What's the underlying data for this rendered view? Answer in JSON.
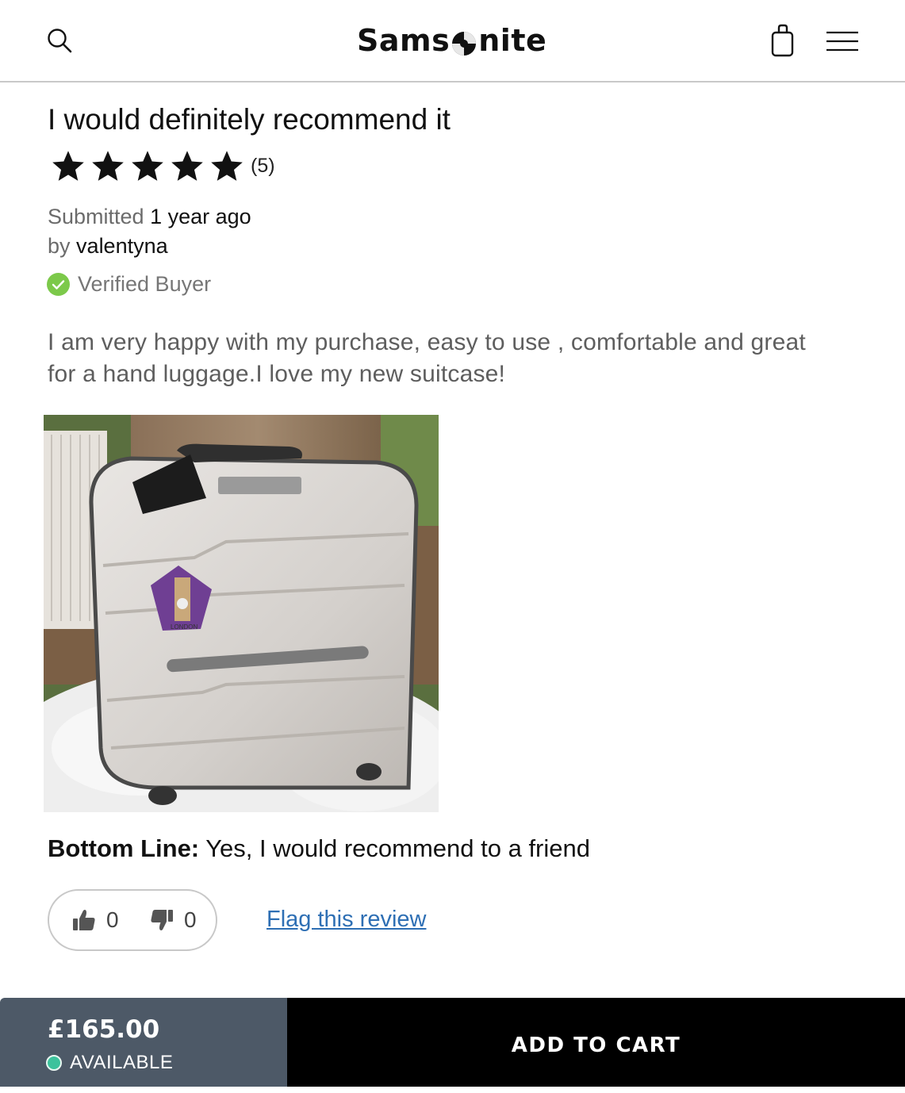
{
  "header": {
    "logo_text_left": "Sams",
    "logo_text_right": "nite",
    "icons": [
      "search-icon",
      "shopping-bag-icon",
      "hamburger-menu-icon"
    ]
  },
  "review": {
    "title": "I would definitely recommend it",
    "rating": 5,
    "rating_max": 5,
    "rating_count_label": "(5)",
    "submitted_label": "Submitted",
    "submitted_value": "1 year ago",
    "by_label": "by",
    "author": "valentyna",
    "verified_label": "Verified Buyer",
    "body": "I am very happy with my purchase, easy to use , comfortable and great for a hand luggage.I love my new suitcase!",
    "photo_sticker_text": "LONDON",
    "bottom_line_label": "Bottom Line:",
    "bottom_line_value": "Yes, I would recommend to a friend",
    "helpful_yes_count": "0",
    "helpful_no_count": "0",
    "flag_label": "Flag this review"
  },
  "footer": {
    "price": "£165.00",
    "availability": "AVAILABLE",
    "add_to_cart": "ADD TO CART"
  },
  "colors": {
    "verified_green": "#7cc94a",
    "link_blue": "#2e6fb4",
    "price_panel": "#4d5967",
    "available_dot": "#3cc29c",
    "cart_button": "#000000"
  }
}
